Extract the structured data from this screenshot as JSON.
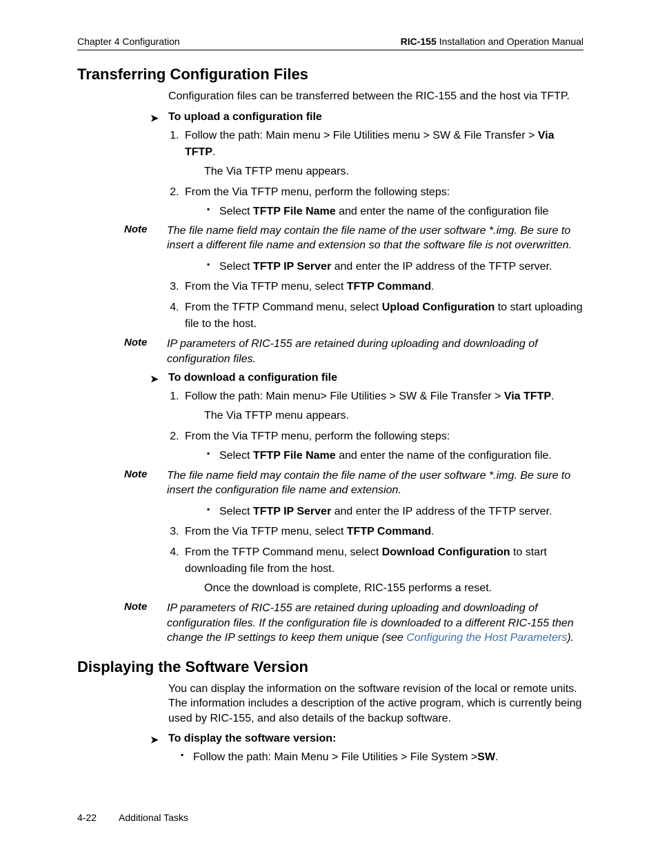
{
  "header": {
    "left": "Chapter 4  Configuration",
    "rightBold": "RIC-155",
    "rightRest": " Installation and Operation Manual"
  },
  "s1": {
    "title": "Transferring Configuration Files",
    "intro": "Configuration files can be transferred between the RIC-155 and the host via TFTP.",
    "proc1": {
      "title": "To upload a configuration file",
      "step1a": "Follow the path: Main menu > File Utilities menu > SW & File Transfer > ",
      "step1b": "Via TFTP",
      "step1c": ".",
      "step1sub": "The Via TFTP menu appears.",
      "step2": "From the Via TFTP menu, perform the following steps:",
      "b1a": "Select ",
      "b1b": "TFTP File Name",
      "b1c": " and enter the name of the configuration file"
    },
    "note1": "The file name field may contain the file name of the user software *.img. Be sure to insert a different file name and extension so that the software file is not overwritten.",
    "b2a": "Select ",
    "b2b": "TFTP IP Server",
    "b2c": " and enter the IP address of the TFTP server.",
    "step3a": "From the Via TFTP menu, select ",
    "step3b": "TFTP Command",
    "step3c": ".",
    "step4a": "From the TFTP Command menu, select ",
    "step4b": "Upload Configuration",
    "step4c": " to start uploading file to the host.",
    "note2": "IP parameters of RIC-155 are retained during uploading and downloading of configuration files.",
    "proc2": {
      "title": "To download a configuration file",
      "step1a": "Follow the path: Main menu> File Utilities > SW & File Transfer > ",
      "step1b": "Via TFTP",
      "step1c": ".",
      "step1sub": "The Via TFTP menu appears.",
      "step2": "From the Via TFTP menu, perform the following steps:",
      "b1a": "Select ",
      "b1b": "TFTP File Name",
      "b1c": " and enter the name of the configuration file."
    },
    "note3": "The file name field may contain the file name of the user software *.img. Be sure to insert the configuration file name and extension.",
    "d_b2a": "Select ",
    "d_b2b": "TFTP IP Server",
    "d_b2c": " and enter the IP address of the TFTP server.",
    "d_step3a": "From the Via TFTP menu, select ",
    "d_step3b": "TFTP Command",
    "d_step3c": ".",
    "d_step4a": "From the TFTP Command menu, select ",
    "d_step4b": "Download Configuration",
    "d_step4c": " to start downloading file from the host.",
    "d_step4sub": "Once the download is complete, RIC-155 performs a reset.",
    "note4a": "IP parameters of RIC-155 are retained during uploading and downloading of configuration files. If the configuration file is downloaded to a different RIC-155 then change the IP settings to keep them unique (see ",
    "note4link": "Configuring the Host Parameters",
    "note4b": ")."
  },
  "s2": {
    "title": "Displaying the Software Version",
    "intro": "You can display the information on the software revision of the local or remote units. The information includes a description of the active program, which is currently being used by RIC-155, and also details of the backup software.",
    "proc": {
      "title": "To display the software version:",
      "b1a": "Follow the path: Main Menu > File Utilities > File System >",
      "b1b": "SW",
      "b1c": "."
    }
  },
  "footer": {
    "pagenum": "4-22",
    "section": "Additional Tasks"
  },
  "noteLabel": "Note"
}
